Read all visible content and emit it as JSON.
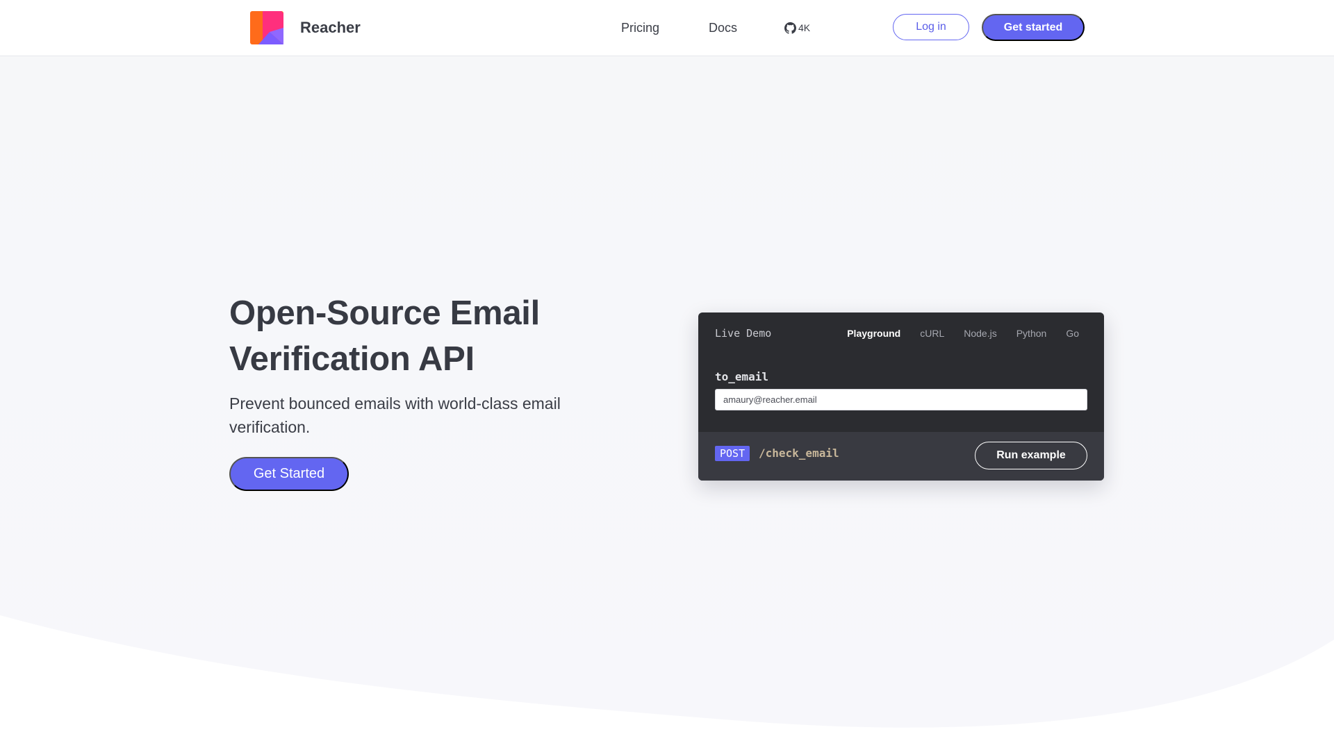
{
  "brand": {
    "name": "Reacher",
    "logo_icon": "reacher-logo-icon",
    "logo_colors": [
      "#ff6b1a",
      "#ff2f7d",
      "#7c5cff"
    ]
  },
  "nav": {
    "pricing": "Pricing",
    "docs": "Docs",
    "github_icon": "github-icon",
    "github_stars": "4K",
    "login": "Log in",
    "get_started": "Get started"
  },
  "hero": {
    "title": "Open-Source Email Verification API",
    "subtitle": "Prevent bounced emails with world-class email verification.",
    "cta": "Get Started"
  },
  "demo": {
    "title": "Live Demo",
    "tabs": [
      {
        "label": "Playground",
        "active": true
      },
      {
        "label": "cURL",
        "active": false
      },
      {
        "label": "Node.js",
        "active": false
      },
      {
        "label": "Python",
        "active": false
      },
      {
        "label": "Go",
        "active": false
      }
    ],
    "field_label": "to_email",
    "field_value": "amaury@reacher.email",
    "method": "POST",
    "endpoint": "/check_email",
    "run_button": "Run example"
  },
  "colors": {
    "accent": "#6366f1",
    "text": "#3a3d46",
    "card_bg": "#2b2c30",
    "card_footer_bg": "#393a41"
  }
}
